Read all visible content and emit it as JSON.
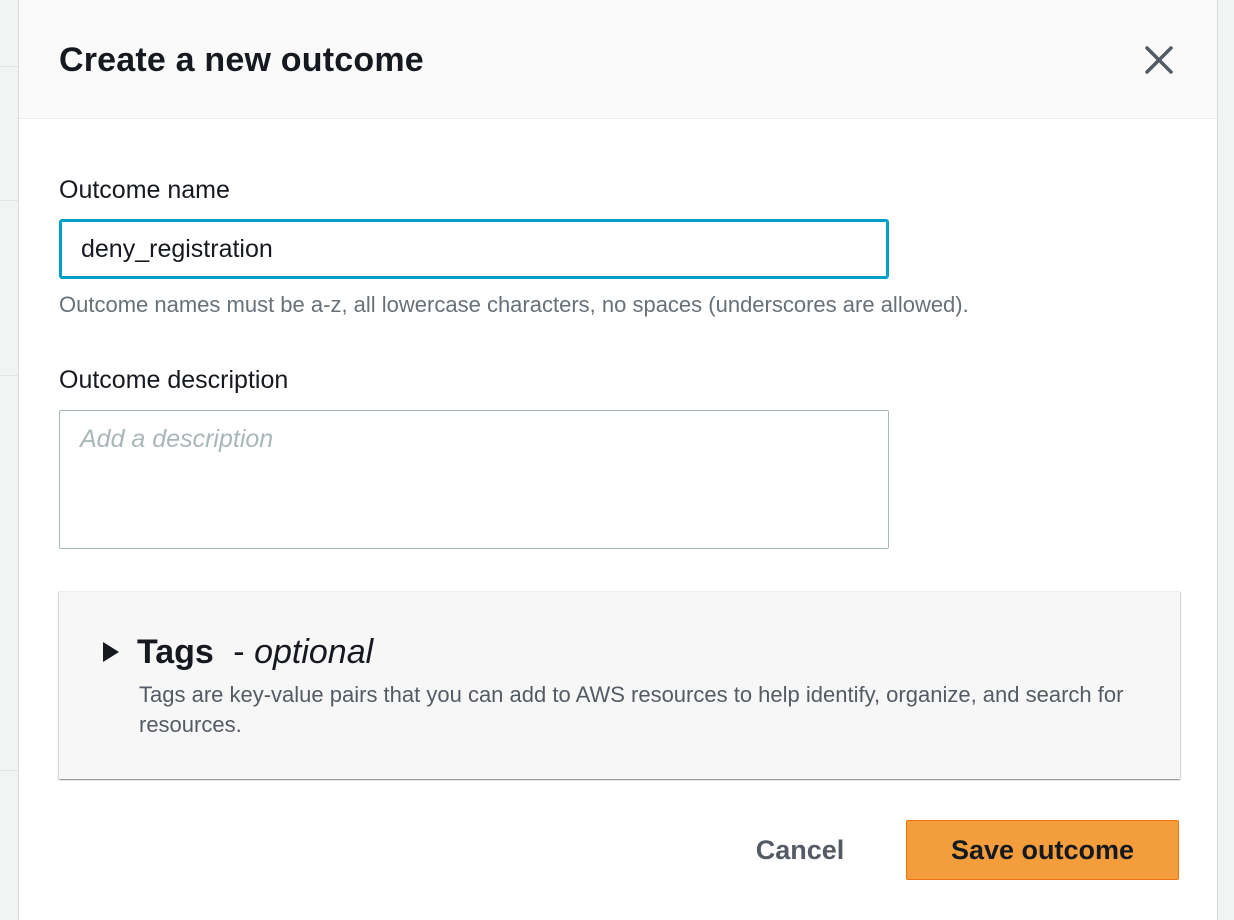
{
  "modal": {
    "title": "Create a new outcome"
  },
  "form": {
    "name_label": "Outcome name",
    "name_value": "deny_registration",
    "name_hint": "Outcome names must be a-z, all lowercase characters, no spaces (underscores are allowed).",
    "description_label": "Outcome description",
    "description_placeholder": "Add a description",
    "description_value": ""
  },
  "tags": {
    "title": "Tags",
    "separator": " - ",
    "optional": "optional",
    "description": "Tags are key-value pairs that you can add to AWS resources to help identify, organize, and search for resources."
  },
  "footer": {
    "cancel_label": "Cancel",
    "save_label": "Save outcome"
  },
  "colors": {
    "primary_button": "#f39d3c",
    "focus_border": "#00a1c9",
    "text": "#16191f",
    "muted_text": "#687078"
  },
  "icons": {
    "close": "close-icon",
    "expand": "caret-right-icon"
  }
}
